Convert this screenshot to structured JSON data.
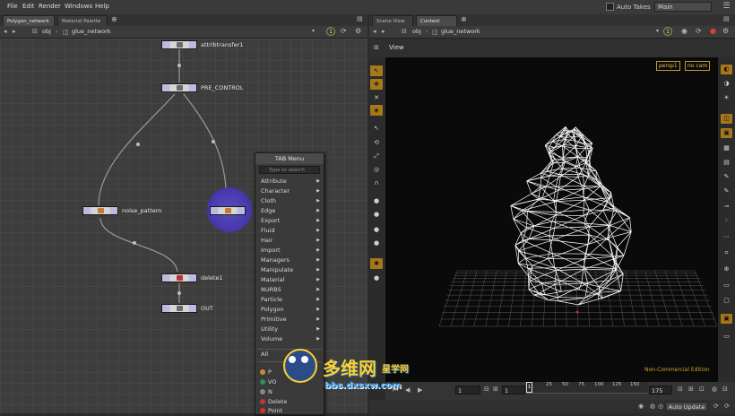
{
  "menubar": {
    "items": [
      "File",
      "Edit",
      "Render",
      "Windows",
      "Help"
    ],
    "auto_takes": "Auto Takes",
    "main_select": "Main"
  },
  "network_pane": {
    "tabs": [
      "Polygon_network",
      "Material Palette"
    ],
    "path": "obj",
    "node_path": "glue_network",
    "circle_label": "1",
    "nodes": {
      "n1": "attribtransfer1",
      "n2": "PRE_CONTROL",
      "n3": "noise_pattern",
      "n5": "delete1",
      "n6": "OUT"
    }
  },
  "tab_menu": {
    "title": "TAB Menu",
    "search_placeholder": "Type to search",
    "items": [
      "Attribute",
      "Character",
      "Cloth",
      "Edge",
      "Export",
      "Fluid",
      "Hair",
      "Import",
      "Managers",
      "Manipulate",
      "Material",
      "NURBS",
      "Particle",
      "Polygon",
      "Primitive",
      "Utility",
      "Volume"
    ],
    "all_label": "All",
    "bottom_items": [
      "P",
      "VO",
      "N",
      "Delete",
      "Point"
    ]
  },
  "scene_pane": {
    "tabs": [
      "Scene View",
      "Context View"
    ],
    "path": "obj",
    "node_path": "glue_network",
    "circle_label": "1",
    "view_label": "View",
    "camera_persp": "persp1",
    "camera_nocam": "no cam",
    "edition": "Non-Commercial Edition"
  },
  "timeline": {
    "start_field": "1",
    "frame_field": "1",
    "current_frame": "1",
    "ticks": [
      "1",
      "25",
      "50",
      "75",
      "100",
      "125",
      "150"
    ],
    "end_field": "175",
    "auto_update": "Auto Update"
  },
  "watermark": {
    "brand_cn": "多维网",
    "brand_cn2": "星学网",
    "url": "bbs.dxsxw.com"
  },
  "colors": {
    "accent_orange": "#a6781a",
    "wire": "#ffffff",
    "grid": "#6a6a6a",
    "edition_text": "#d0a030"
  }
}
